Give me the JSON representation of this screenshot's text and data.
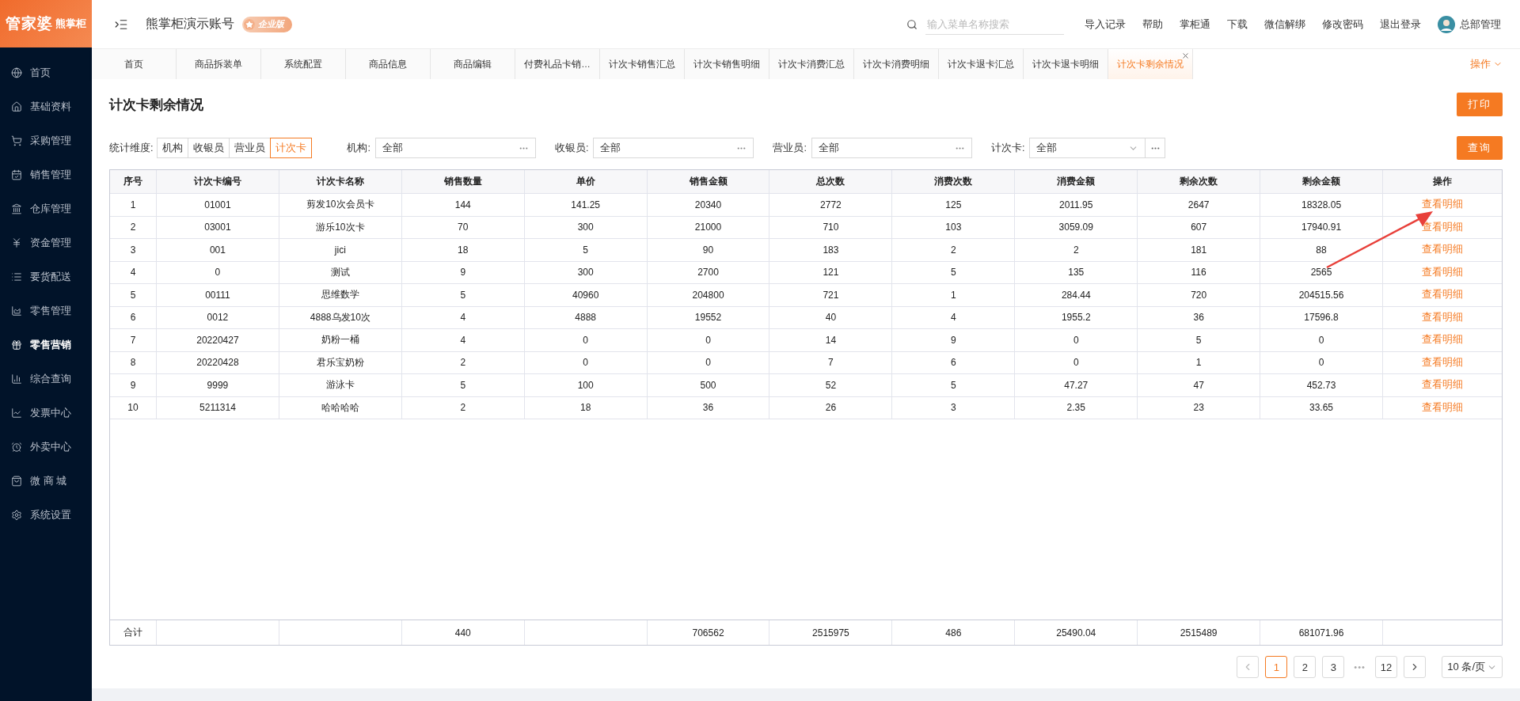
{
  "logo": {
    "main": "管家婆",
    "sub": "熊掌柜"
  },
  "header": {
    "account": "熊掌柜演示账号",
    "badge": "企业版",
    "search": {
      "placeholder": "输入菜单名称搜索"
    },
    "links": [
      "导入记录",
      "帮助",
      "掌柜通",
      "下载",
      "微信解绑",
      "修改密码",
      "退出登录"
    ],
    "user": "总部管理"
  },
  "sidebar": {
    "items": [
      {
        "label": "首页",
        "selected": false
      },
      {
        "label": "基础资料",
        "selected": false
      },
      {
        "label": "采购管理",
        "selected": false
      },
      {
        "label": "销售管理",
        "selected": false
      },
      {
        "label": "仓库管理",
        "selected": false
      },
      {
        "label": "资金管理",
        "selected": false
      },
      {
        "label": "要货配送",
        "selected": false
      },
      {
        "label": "零售管理",
        "selected": false
      },
      {
        "label": "零售营销",
        "selected": true
      },
      {
        "label": "综合查询",
        "selected": false
      },
      {
        "label": "发票中心",
        "selected": false
      },
      {
        "label": "外卖中心",
        "selected": false
      },
      {
        "label": "微 商 城",
        "selected": false
      },
      {
        "label": "系统设置",
        "selected": false
      }
    ]
  },
  "tabs": [
    {
      "label": "首页",
      "selected": false,
      "closable": false
    },
    {
      "label": "商品拆装单",
      "selected": false,
      "closable": false
    },
    {
      "label": "系统配置",
      "selected": false,
      "closable": false
    },
    {
      "label": "商品信息",
      "selected": false,
      "closable": false
    },
    {
      "label": "商品编辑",
      "selected": false,
      "closable": false
    },
    {
      "label": "付费礼品卡销…",
      "selected": false,
      "closable": false
    },
    {
      "label": "计次卡销售汇总",
      "selected": false,
      "closable": false
    },
    {
      "label": "计次卡销售明细",
      "selected": false,
      "closable": false
    },
    {
      "label": "计次卡消费汇总",
      "selected": false,
      "closable": false
    },
    {
      "label": "计次卡消费明细",
      "selected": false,
      "closable": false
    },
    {
      "label": "计次卡退卡汇总",
      "selected": false,
      "closable": false
    },
    {
      "label": "计次卡退卡明细",
      "selected": false,
      "closable": false
    },
    {
      "label": "计次卡剩余情况",
      "selected": true,
      "closable": true
    }
  ],
  "tab_actions": "操作",
  "page_title": "计次卡剩余情况",
  "print_button": "打印",
  "filters": {
    "dimension": {
      "label": "统计维度:",
      "options": [
        {
          "label": "机构",
          "selected": false
        },
        {
          "label": "收银员",
          "selected": false
        },
        {
          "label": "营业员",
          "selected": false
        },
        {
          "label": "计次卡",
          "selected": true
        }
      ]
    },
    "fields": [
      {
        "label": "机构:",
        "value": "全部",
        "kind": "picker"
      },
      {
        "label": "收银员:",
        "value": "全部",
        "kind": "picker"
      },
      {
        "label": "营业员:",
        "value": "全部",
        "kind": "picker"
      },
      {
        "label": "计次卡:",
        "value": "全部",
        "kind": "select"
      }
    ],
    "query_button": "查询"
  },
  "table": {
    "columns": [
      "序号",
      "计次卡编号",
      "计次卡名称",
      "销售数量",
      "单价",
      "销售金额",
      "总次数",
      "消费次数",
      "消费金额",
      "剩余次数",
      "剩余金额",
      "操作"
    ],
    "rows": [
      [
        "1",
        "01001",
        "剪发10次会员卡",
        "144",
        "141.25",
        "20340",
        "2772",
        "125",
        "2011.95",
        "2647",
        "18328.05",
        "查看明细"
      ],
      [
        "2",
        "03001",
        "游乐10次卡",
        "70",
        "300",
        "21000",
        "710",
        "103",
        "3059.09",
        "607",
        "17940.91",
        "查看明细"
      ],
      [
        "3",
        "001",
        "jici",
        "18",
        "5",
        "90",
        "183",
        "2",
        "2",
        "181",
        "88",
        "查看明细"
      ],
      [
        "4",
        "0",
        "测试",
        "9",
        "300",
        "2700",
        "121",
        "5",
        "135",
        "116",
        "2565",
        "查看明细"
      ],
      [
        "5",
        "00111",
        "思维数学",
        "5",
        "40960",
        "204800",
        "721",
        "1",
        "284.44",
        "720",
        "204515.56",
        "查看明细"
      ],
      [
        "6",
        "0012",
        "4888乌发10次",
        "4",
        "4888",
        "19552",
        "40",
        "4",
        "1955.2",
        "36",
        "17596.8",
        "查看明细"
      ],
      [
        "7",
        "20220427",
        "奶粉一桶",
        "4",
        "0",
        "0",
        "14",
        "9",
        "0",
        "5",
        "0",
        "查看明细"
      ],
      [
        "8",
        "20220428",
        "君乐宝奶粉",
        "2",
        "0",
        "0",
        "7",
        "6",
        "0",
        "1",
        "0",
        "查看明细"
      ],
      [
        "9",
        "9999",
        "游泳卡",
        "5",
        "100",
        "500",
        "52",
        "5",
        "47.27",
        "47",
        "452.73",
        "查看明细"
      ],
      [
        "10",
        "5211314",
        "哈哈哈哈",
        "2",
        "18",
        "36",
        "26",
        "3",
        "2.35",
        "23",
        "33.65",
        "查看明细"
      ]
    ],
    "footer": {
      "label": "合计",
      "sales_quantity": "440",
      "sales_amount": "706562",
      "total_uses": "2515975",
      "used_uses": "486",
      "used_amount": "25490.04",
      "remaining_uses": "2515489",
      "remaining_amount": "681071.96"
    }
  },
  "pagination": {
    "pages": [
      {
        "label": "1",
        "selected": true
      },
      {
        "label": "2",
        "selected": false
      },
      {
        "label": "3",
        "selected": false
      },
      {
        "label": "•••",
        "selected": false
      },
      {
        "label": "12",
        "selected": false
      }
    ],
    "page_size": "10 条/页"
  }
}
